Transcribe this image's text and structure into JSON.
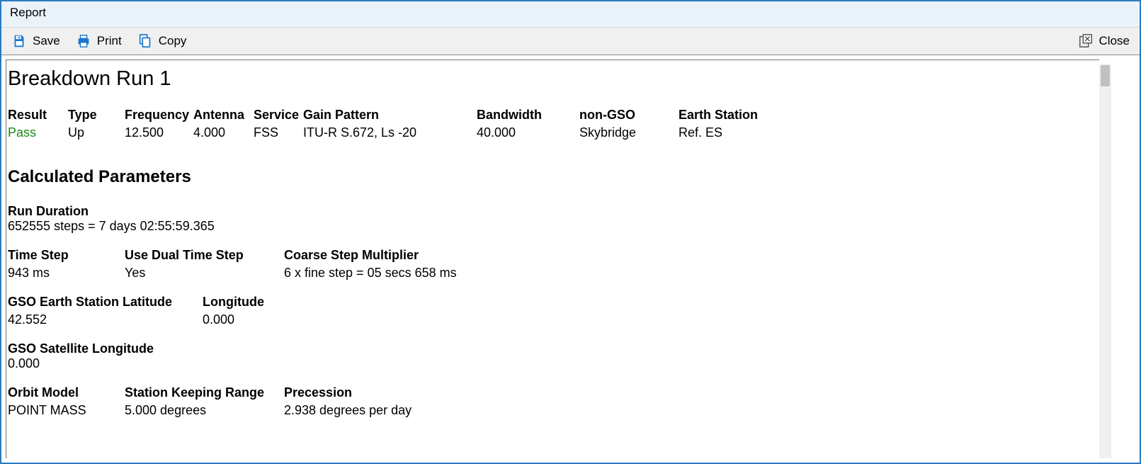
{
  "window": {
    "title": "Report"
  },
  "toolbar": {
    "save": "Save",
    "print": "Print",
    "copy": "Copy",
    "close": "Close"
  },
  "report": {
    "title": "Breakdown Run 1",
    "summary": {
      "headers": {
        "result": "Result",
        "type": "Type",
        "frequency": "Frequency",
        "antenna": "Antenna",
        "service": "Service",
        "gain_pattern": "Gain Pattern",
        "bandwidth": "Bandwidth",
        "non_gso": "non-GSO",
        "earth_station": "Earth Station"
      },
      "values": {
        "result": "Pass",
        "type": "Up",
        "frequency": "12.500",
        "antenna": "4.000",
        "service": "FSS",
        "gain_pattern": "ITU-R S.672, Ls -20",
        "bandwidth": "40.000",
        "non_gso": "Skybridge",
        "earth_station": "Ref. ES"
      }
    },
    "section_title": "Calculated Parameters",
    "run_duration": {
      "label": "Run Duration",
      "value": "652555 steps = 7 days 02:55:59.365"
    },
    "time_step": {
      "label": "Time Step",
      "value": "943 ms"
    },
    "use_dual": {
      "label": "Use Dual Time Step",
      "value": "Yes"
    },
    "coarse": {
      "label": "Coarse Step Multiplier",
      "value": "6 x fine step = 05 secs 658 ms"
    },
    "es_lat": {
      "label": "GSO Earth Station Latitude",
      "value": "42.552"
    },
    "es_lon": {
      "label": "Longitude",
      "value": "0.000"
    },
    "sat_lon": {
      "label": "GSO Satellite Longitude",
      "value": "0.000"
    },
    "orbit_model": {
      "label": "Orbit Model",
      "value": "POINT MASS"
    },
    "sk_range": {
      "label": "Station Keeping Range",
      "value": "5.000 degrees"
    },
    "precession": {
      "label": "Precession",
      "value": "2.938 degrees per day"
    }
  }
}
